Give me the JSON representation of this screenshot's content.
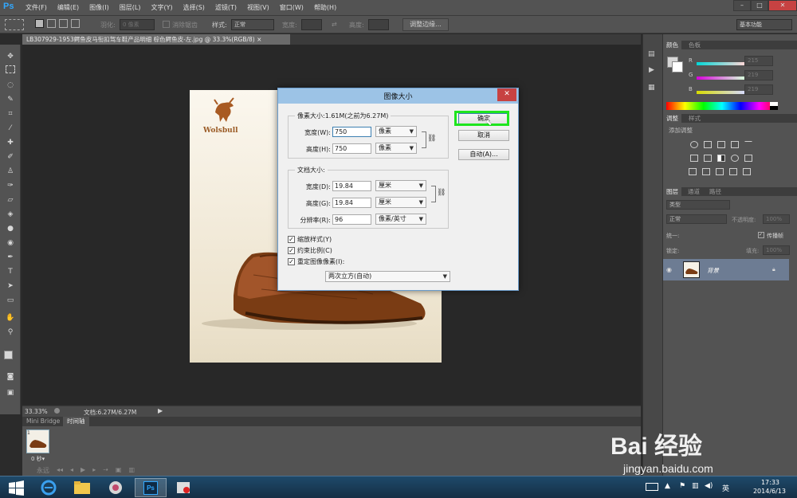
{
  "app": {
    "logo": "Ps"
  },
  "menu": [
    "文件(F)",
    "编辑(E)",
    "图像(I)",
    "图层(L)",
    "文字(Y)",
    "选择(S)",
    "滤镜(T)",
    "视图(V)",
    "窗口(W)",
    "帮助(H)"
  ],
  "window_controls": {
    "minimize": "–",
    "restore": "□",
    "close": "✕"
  },
  "options": {
    "feather_label": "羽化:",
    "feather_value": "0 像素",
    "antialias_label": "消除锯齿",
    "style_label": "样式:",
    "style_value": "正常",
    "width_label": "宽度:",
    "height_label": "高度:",
    "refine_edge": "调整边缘...",
    "workspace": "基本功能"
  },
  "document_tab": {
    "title": "LB307929-1953鳄鱼皮马衔扣驾车鞋产品明细 棕色鳄鱼皮-左.jpg @ 33.3%(RGB/8)",
    "close": "×"
  },
  "canvas": {
    "brand": "Wolsbull"
  },
  "status": {
    "zoom": "33.33%",
    "doc": "文档:6.27M/6.27M"
  },
  "bottom": {
    "tabs": [
      "Mini Bridge",
      "时间轴"
    ],
    "frame_number": "1",
    "frame_time": "0 秒▾",
    "loop": "永远"
  },
  "panels": {
    "color_tabs": [
      "颜色",
      "色板"
    ],
    "rgb": [
      {
        "label": "R",
        "value": "215",
        "color": "#d7d7d7"
      },
      {
        "label": "G",
        "value": "219",
        "color": "#dbdbdb"
      },
      {
        "label": "B",
        "value": "219",
        "color": "#dbdbdb"
      }
    ],
    "adjust_tabs": [
      "调整",
      "样式"
    ],
    "adjust_hint": "添加调整",
    "layer_tabs": [
      "图层",
      "通道",
      "路径"
    ],
    "layer_kind": "类型",
    "blend_mode": "正常",
    "opacity_label": "不透明度:",
    "opacity_value": "100%",
    "unify_label": "统一:",
    "propagate_label": "传播帧",
    "lock_label": "锁定:",
    "fill_label": "填充:",
    "fill_value": "100%",
    "layer_name": "背景"
  },
  "dialog": {
    "title": "图像大小",
    "pixel_group": "像素大小:1.61M(之前为6.27M)",
    "width_label": "宽度(W):",
    "width_value": "750",
    "width_unit": "像素",
    "height_label": "高度(H):",
    "height_value": "750",
    "height_unit": "像素",
    "doc_group": "文档大小:",
    "doc_width_label": "宽度(D):",
    "doc_width_value": "19.84",
    "doc_width_unit": "厘米",
    "doc_height_label": "高度(G):",
    "doc_height_value": "19.84",
    "doc_height_unit": "厘米",
    "resolution_label": "分辨率(R):",
    "resolution_value": "96",
    "resolution_unit": "像素/英寸",
    "scale_styles": "缩放样式(Y)",
    "constrain": "约束比例(C)",
    "resample": "重定图像像素(I):",
    "resample_method": "两次立方(自动)",
    "ok": "确定",
    "cancel": "取消",
    "auto": "自动(A)...",
    "close": "✕"
  },
  "taskbar": {
    "ime": "英",
    "time": "17:33",
    "date": "2014/6/13"
  },
  "watermark": {
    "brand": "Bai 经验",
    "url": "jingyan.baidu.com"
  }
}
